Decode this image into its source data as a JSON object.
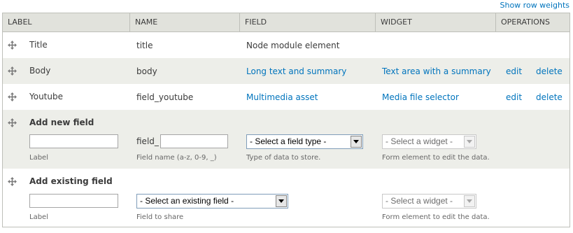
{
  "show_row_weights": "Show row weights",
  "headers": [
    "LABEL",
    "NAME",
    "FIELD",
    "WIDGET",
    "OPERATIONS"
  ],
  "rows": [
    {
      "label": "Title",
      "name": "title",
      "field": "Node module element",
      "widget": "",
      "edit": "",
      "delete": ""
    },
    {
      "label": "Body",
      "name": "body",
      "field": "Long text and summary",
      "widget": "Text area with a summary",
      "edit": "edit",
      "delete": "delete"
    },
    {
      "label": "Youtube",
      "name": "field_youtube",
      "field": "Multimedia asset",
      "widget": "Media file selector",
      "edit": "edit",
      "delete": "delete"
    }
  ],
  "add_new": {
    "title": "Add new field",
    "label_value": "",
    "label_desc": "Label",
    "field_prefix": "field_",
    "field_name_value": "",
    "field_name_desc": "Field name (a-z, 0-9, _)",
    "type_select": "- Select a field type -",
    "type_desc": "Type of data to store.",
    "widget_select": "- Select a widget -",
    "widget_desc": "Form element to edit the data."
  },
  "add_existing": {
    "title": "Add existing field",
    "label_value": "",
    "label_desc": "Label",
    "existing_select": "- Select an existing field -",
    "existing_desc": "Field to share",
    "widget_select": "- Select a widget -",
    "widget_desc": "Form element to edit the data."
  },
  "colors": {
    "link": "#0074bd",
    "header_bg": "#e1e2dc",
    "even_row_bg": "#edeee9",
    "border": "#bebfb9"
  }
}
